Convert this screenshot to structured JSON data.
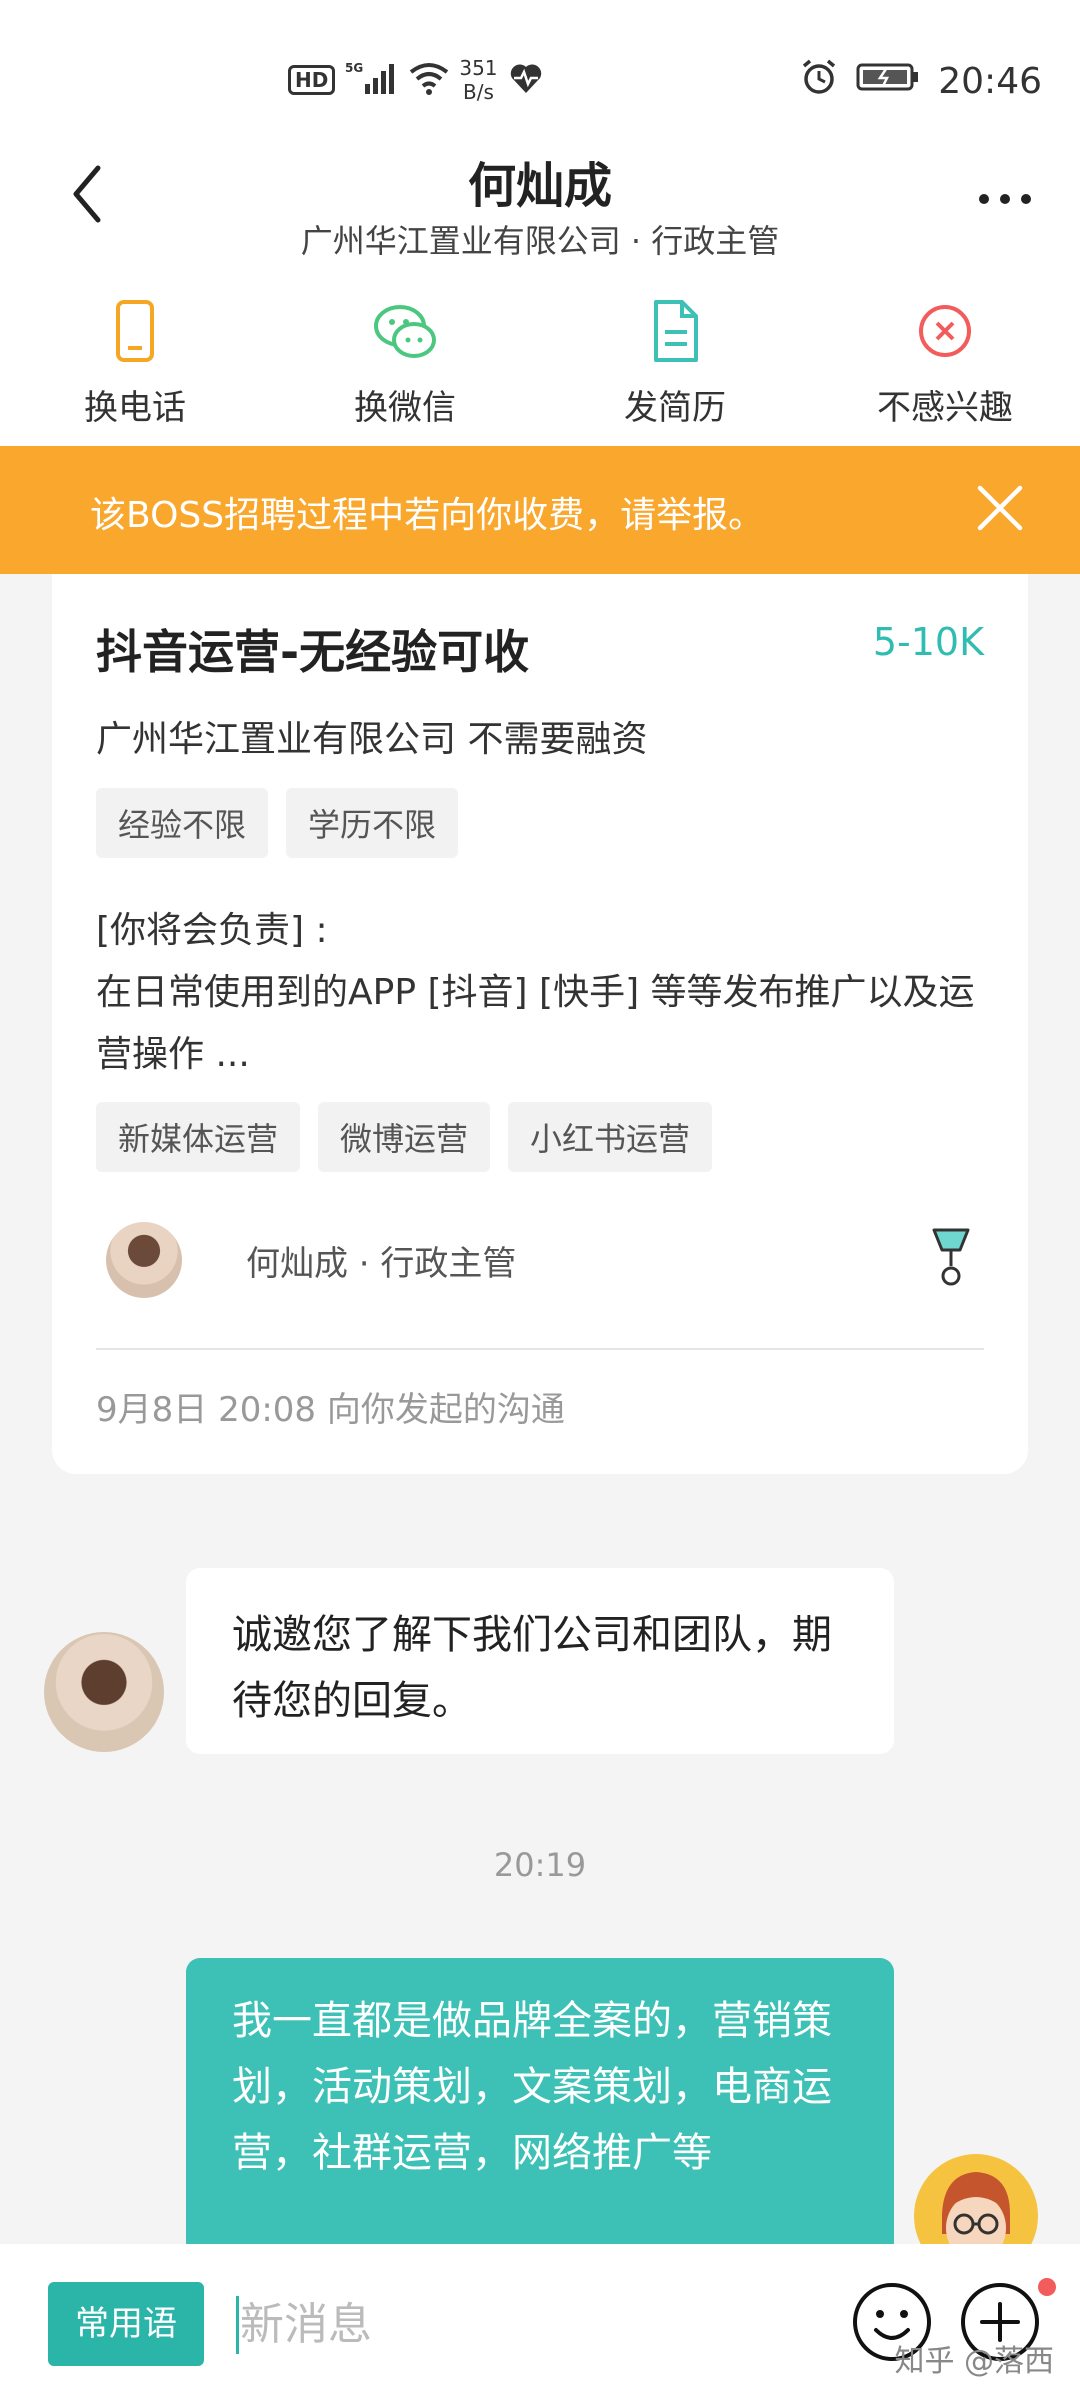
{
  "status_bar": {
    "network": "5G",
    "hd": "HD",
    "speed_value": "351",
    "speed_unit": "B/s",
    "time": "20:46"
  },
  "header": {
    "title": "何灿成",
    "subtitle": "广州华江置业有限公司 · 行政主管"
  },
  "actions": [
    {
      "label": "换电话",
      "icon": "phone-icon",
      "color": "#f5a623"
    },
    {
      "label": "换微信",
      "icon": "wechat-icon",
      "color": "#4cc77f"
    },
    {
      "label": "发简历",
      "icon": "resume-icon",
      "color": "#3dc1b6"
    },
    {
      "label": "不感兴趣",
      "icon": "not-interested-icon",
      "color": "#f25c5c"
    }
  ],
  "warning": {
    "text": "该BOSS招聘过程中若向你收费，请举报。"
  },
  "job_card": {
    "title": "抖音运营-无经验可收",
    "salary": "5-10K",
    "company": "广州华江置业有限公司  不需要融资",
    "requirements": [
      "经验不限",
      "学历不限"
    ],
    "description_line1": "[你将会负责] :",
    "description_line2": "在日常使用到的APP [抖音] [快手] 等等发布推广以及运营操作 ...",
    "skills": [
      "新媒体运营",
      "微博运营",
      "小红书运营"
    ],
    "boss": "何灿成 · 行政主管",
    "initiated": "9月8日 20:08 向你发起的沟通"
  },
  "messages": {
    "incoming": "诚邀您了解下我们公司和团队，期待您的回复。",
    "time": "20:19",
    "outgoing": "我一直都是做品牌全案的，营销策划，活动策划，文案策划，电商运营，社群运营，网络推广等"
  },
  "input_bar": {
    "quick_phrases": "常用语",
    "placeholder": "新消息"
  },
  "watermark": "知乎 @落西",
  "colors": {
    "accent": "#3dc1b6",
    "warning": "#f9a72d"
  }
}
